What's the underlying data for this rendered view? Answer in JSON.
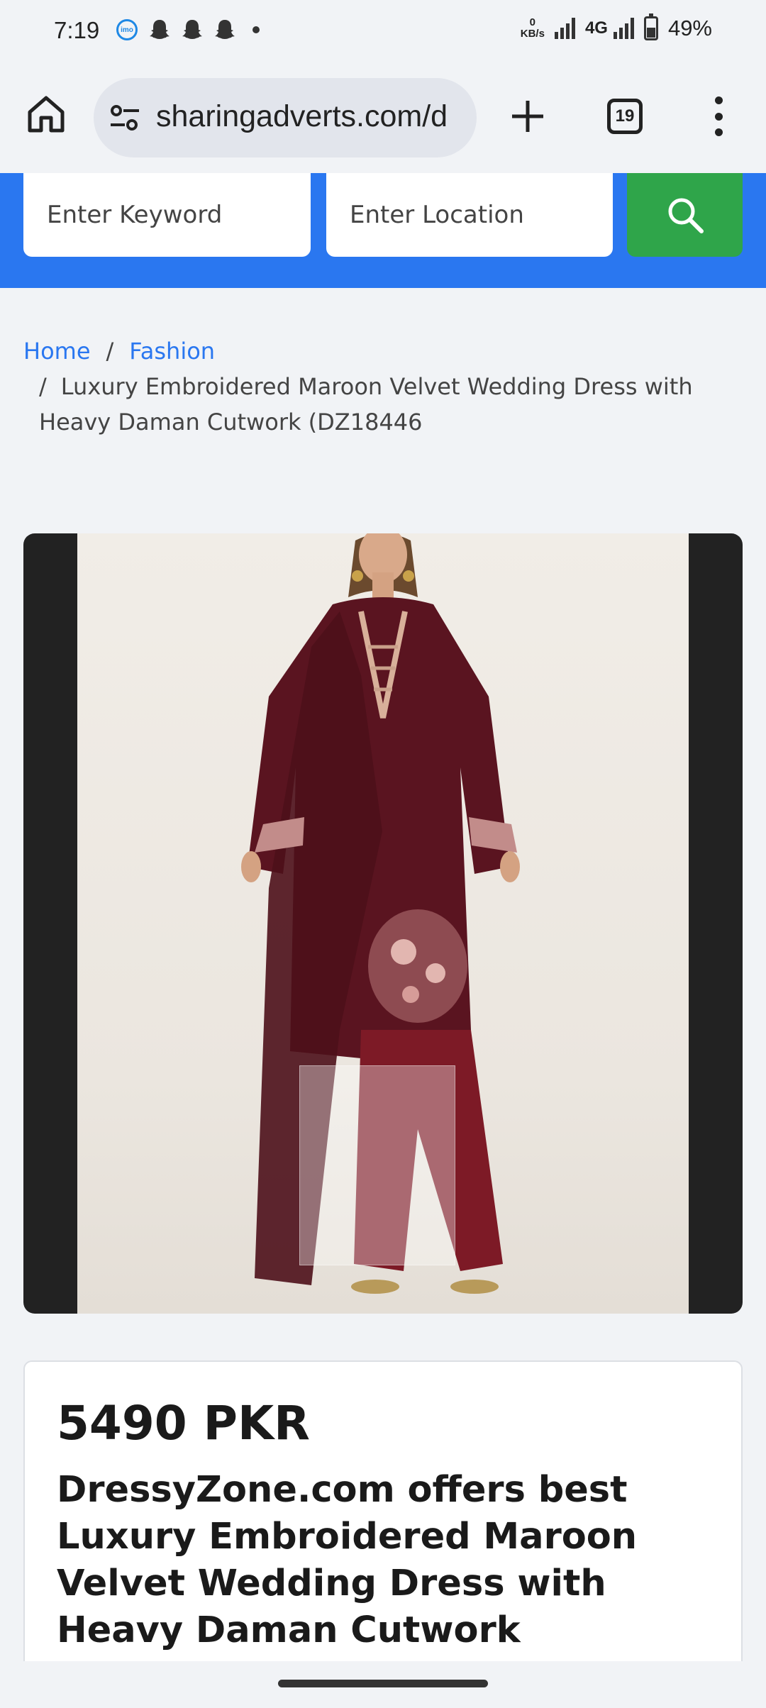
{
  "status_bar": {
    "time": "7:19",
    "net_speed_value": "0",
    "net_speed_unit": "KB/s",
    "network": "4G",
    "battery": "49%",
    "battery_level": 0.49
  },
  "browser": {
    "url": "sharingadverts.com/d",
    "tab_count": "19"
  },
  "search": {
    "keyword_placeholder": "Enter Keyword",
    "location_placeholder": "Enter Location"
  },
  "breadcrumb": {
    "home": "Home",
    "separator": "/",
    "category": "Fashion",
    "current": "Luxury Embroidered Maroon Velvet Wedding Dress with Heavy Daman Cutwork (DZ18446"
  },
  "listing": {
    "price": "5490 PKR",
    "title": "DressyZone.com offers best Luxury Embroidered Maroon Velvet Wedding Dress with Heavy Daman Cutwork"
  },
  "colors": {
    "accent_blue": "#2a77f0",
    "search_green": "#2fa54a",
    "dress_maroon": "#5a1420"
  }
}
